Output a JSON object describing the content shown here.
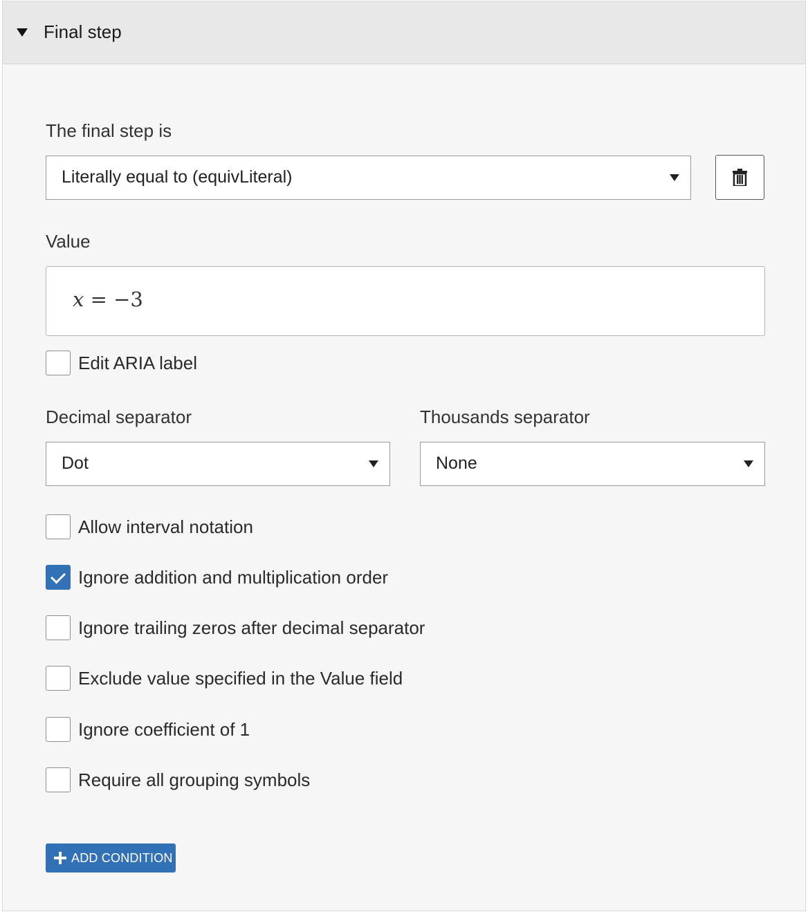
{
  "header": {
    "title": "Final step",
    "toggle_icon": "caret-down-icon"
  },
  "final_step": {
    "label": "The final step is",
    "selected": "Literally equal to (equivLiteral)",
    "delete_icon": "trash-icon"
  },
  "value": {
    "label": "Value",
    "math": {
      "var": "x",
      "rest": " = −3"
    }
  },
  "aria": {
    "label": "Edit ARIA label",
    "checked": false
  },
  "decimal": {
    "label": "Decimal separator",
    "selected": "Dot"
  },
  "thousands": {
    "label": "Thousands separator",
    "selected": "None"
  },
  "options": [
    {
      "label": "Allow interval notation",
      "checked": false
    },
    {
      "label": "Ignore addition and multiplication order",
      "checked": true
    },
    {
      "label": "Ignore trailing zeros after decimal separator",
      "checked": false
    },
    {
      "label": "Exclude value specified in the Value field",
      "checked": false
    },
    {
      "label": "Ignore coefficient of 1",
      "checked": false
    },
    {
      "label": "Require all grouping symbols",
      "checked": false
    }
  ],
  "add_condition": {
    "label": "ADD CONDITION",
    "icon": "plus-icon"
  },
  "colors": {
    "accent": "#3271b6",
    "panel_bg": "#f6f6f6",
    "header_bg": "#e8e8e8"
  }
}
